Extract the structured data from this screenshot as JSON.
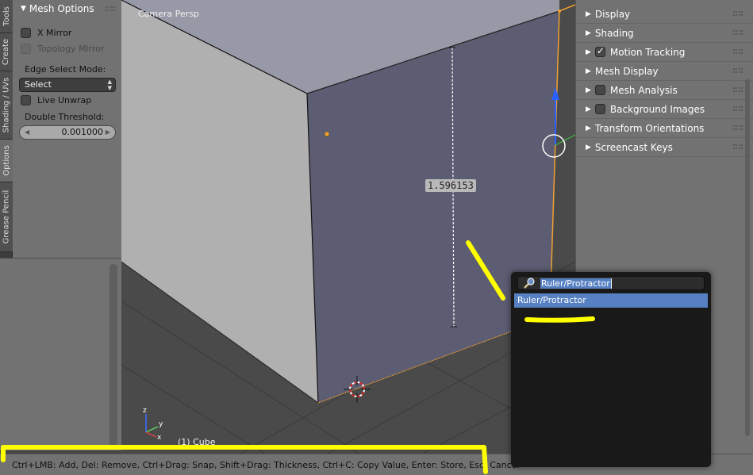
{
  "left_tabs": [
    "Tools",
    "Create",
    "Shading / UVs",
    "Options",
    "Grease Pencil"
  ],
  "mesh_options": {
    "title": "Mesh Options",
    "x_mirror": "X Mirror",
    "topology_mirror": "Topology Mirror",
    "edge_select_mode_label": "Edge Select Mode:",
    "edge_select_mode_value": "Select",
    "live_unwrap": "Live Unwrap",
    "double_threshold_label": "Double Threshold:",
    "double_threshold_value": "0.001000"
  },
  "viewport": {
    "view_label": "Camera Persp",
    "object_label": "(1) Cube",
    "measurement": "1.596153"
  },
  "right_panel": {
    "rows": [
      {
        "label": "Display",
        "checkbox": false
      },
      {
        "label": "Shading",
        "checkbox": false
      },
      {
        "label": "Motion Tracking",
        "checkbox": true,
        "checked": true
      },
      {
        "label": "Mesh Display",
        "checkbox": false
      },
      {
        "label": "Mesh Analysis",
        "checkbox": true,
        "checked": false
      },
      {
        "label": "Background Images",
        "checkbox": true,
        "checked": false
      },
      {
        "label": "Transform Orientations",
        "checkbox": false
      },
      {
        "label": "Screencast Keys",
        "checkbox": false
      }
    ]
  },
  "search": {
    "query": "Ruler/Protractor",
    "result": "Ruler/Protractor"
  },
  "status": {
    "text": "Ctrl+LMB: Add, Del: Remove, Ctrl+Drag: Snap, Shift+Drag: Thickness, Ctrl+C: Copy Value, Enter: Store,  Esc: Cancel"
  },
  "colors": {
    "highlight": "#ffff00",
    "selection_blue": "#5680c2",
    "edge_orange": "#f0a030"
  },
  "icons": [
    "search-icon",
    "checkmark-icon",
    "expand-triangle-icon",
    "axis-gizmo-icon",
    "3d-cursor-icon"
  ]
}
